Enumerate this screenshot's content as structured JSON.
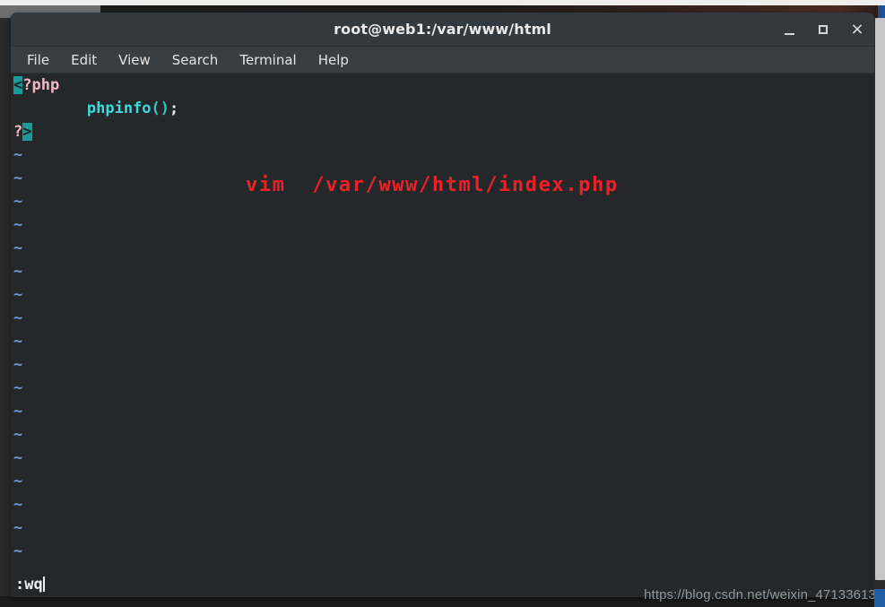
{
  "window": {
    "title": "root@web1:/var/www/html",
    "controls": {
      "minimize_label": "_",
      "maximize_label": "□",
      "close_label": "×"
    }
  },
  "menubar": {
    "items": [
      {
        "label": "File"
      },
      {
        "label": "Edit"
      },
      {
        "label": "View"
      },
      {
        "label": "Search"
      },
      {
        "label": "Terminal"
      },
      {
        "label": "Help"
      }
    ]
  },
  "editor": {
    "line1": {
      "open_bracket": "<",
      "rest": "?php"
    },
    "line2": {
      "indent": "        ",
      "function_name": "phpinfo",
      "parens": "()",
      "semicolon": ";"
    },
    "line3": {
      "question": "?",
      "close_bracket": ">"
    },
    "tilde": "~",
    "tilde_count": 19
  },
  "annotation": {
    "text": "vim  /var/www/html/index.php",
    "color": "#ee2026"
  },
  "statusline": {
    "command": ":wq"
  },
  "watermark": {
    "text": "https://blog.csdn.net/weixin_47133613"
  },
  "colors": {
    "terminal_bg": "#24282b",
    "titlebar_bg": "#333a3f",
    "menubar_bg": "#383f44",
    "cursor_teal": "#1b9a9a",
    "php_tag_pink": "#f2b9c4",
    "func_cyan": "#3fd9d9",
    "tilde_blue": "#6f9ad1",
    "annotation_red": "#ee2026"
  }
}
